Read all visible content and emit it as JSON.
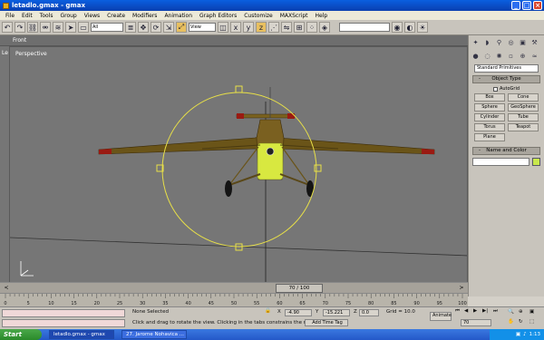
{
  "window": {
    "title": "letadlo.gmax - gmax",
    "controls": [
      "_",
      "□",
      "×"
    ]
  },
  "menu": [
    "File",
    "Edit",
    "Tools",
    "Group",
    "Views",
    "Create",
    "Modifiers",
    "Animation",
    "Graph Editors",
    "Customize",
    "MAXScript",
    "Help"
  ],
  "toolbar": {
    "selection_filter": "All",
    "coord_system": "View"
  },
  "viewports": {
    "top_label": "Front",
    "side_label": "Le",
    "main_label": "Perspective"
  },
  "command_panel": {
    "category": "Standard Primitives",
    "object_type": "Object Type",
    "autogrid": "AutoGrid",
    "primitives": [
      "Box",
      "Cone",
      "Sphere",
      "GeoSphere",
      "Cylinder",
      "Tube",
      "Torus",
      "Teapot",
      "Plane",
      ""
    ],
    "name_color": "Name and Color",
    "name_color_swatch": "#c8e84c"
  },
  "timeline": {
    "position": "70 / 100",
    "prev": "<",
    "next": ">",
    "ticks": [
      "0",
      "5",
      "10",
      "15",
      "20",
      "25",
      "30",
      "35",
      "40",
      "45",
      "50",
      "55",
      "60",
      "65",
      "70",
      "75",
      "80",
      "85",
      "90",
      "95",
      "100"
    ]
  },
  "status": {
    "selection": "None Selected",
    "prompt": "Click and drag to rotate the view.  Clicking in the tabs constrains the rotation",
    "x_value": "-4.90",
    "y_value": "-15.221",
    "z_value": "0.0",
    "grid": "Grid = 10.0",
    "add_time_tag": "Add Time Tag",
    "animate": "Animate",
    "frame": "70"
  },
  "taskbar": {
    "start": "Start",
    "tasks": [
      "letadlo.gmax - gmax",
      "27. Jarome Nohavica ..."
    ],
    "clock": "1:13"
  }
}
